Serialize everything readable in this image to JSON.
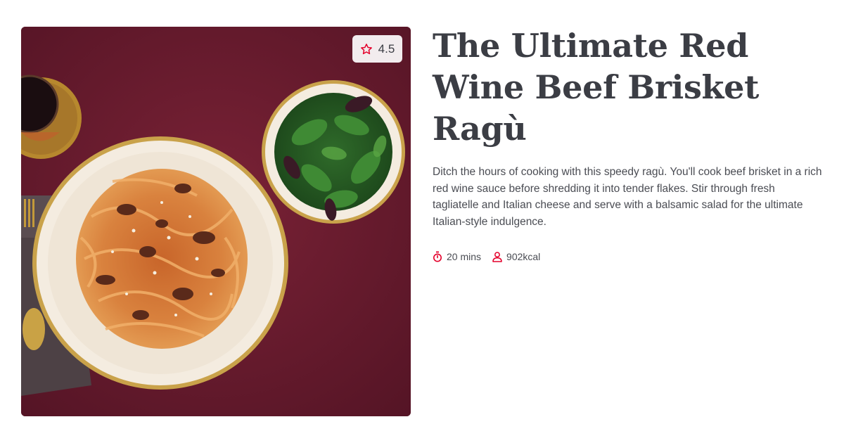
{
  "recipe": {
    "title": "The Ultimate Red Wine Beef Brisket Ragù",
    "description": "Ditch the hours of cooking with this speedy ragù. You'll cook beef brisket in a rich red wine sauce before shredding it into tender flakes. Stir through fresh tagliatelle and Italian cheese and serve with a balsamic salad for the ultimate Italian-style indulgence.",
    "rating": "4.5",
    "time": "20 mins",
    "calories": "902kcal"
  },
  "icons": {
    "rating": "star-icon",
    "time": "stopwatch-icon",
    "calories": "person-icon"
  },
  "colors": {
    "accent": "#e4002b",
    "text": "#3b3d44",
    "background_cloth": "#6a1a2e"
  }
}
